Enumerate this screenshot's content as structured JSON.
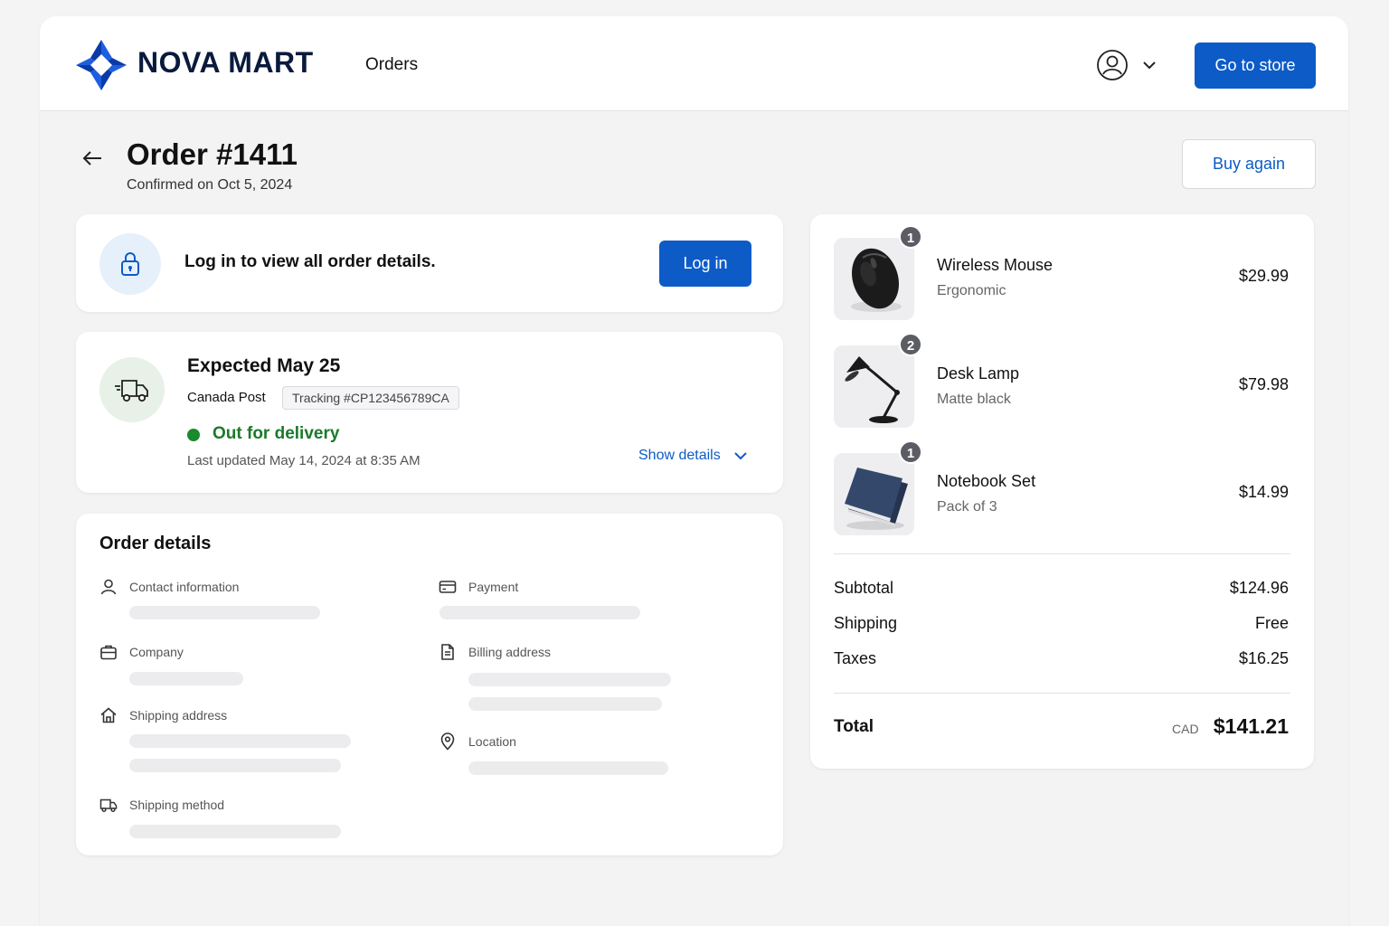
{
  "header": {
    "brand": "NOVA MART",
    "nav_orders": "Orders",
    "go_to_store": "Go to store",
    "accent": "#0d5bc7"
  },
  "order": {
    "title": "Order #1411",
    "confirmed": "Confirmed on Oct 5, 2024",
    "buy_again": "Buy again"
  },
  "login_card": {
    "message": "Log in to view all order details.",
    "button": "Log in"
  },
  "delivery": {
    "expected": "Expected May 25",
    "carrier": "Canada Post",
    "tracking": "Tracking #CP123456789CA",
    "status": "Out for delivery",
    "status_color": "#1a8a2e",
    "updated": "Last updated May 14, 2024 at 8:35 AM",
    "show_details": "Show details"
  },
  "details": {
    "title": "Order details",
    "fields": {
      "contact": "Contact information",
      "company": "Company",
      "shipping_address": "Shipping address",
      "shipping_method": "Shipping method",
      "payment": "Payment",
      "billing_address": "Billing address",
      "location": "Location"
    }
  },
  "items": [
    {
      "qty": "1",
      "name": "Wireless Mouse",
      "variant": "Ergonomic",
      "price": "$29.99"
    },
    {
      "qty": "2",
      "name": "Desk Lamp",
      "variant": "Matte black",
      "price": "$79.98"
    },
    {
      "qty": "1",
      "name": "Notebook Set",
      "variant": "Pack of 3",
      "price": "$14.99"
    }
  ],
  "summary": {
    "subtotal_label": "Subtotal",
    "subtotal": "$124.96",
    "shipping_label": "Shipping",
    "shipping": "Free",
    "taxes_label": "Taxes",
    "taxes": "$16.25",
    "total_label": "Total",
    "currency": "CAD",
    "total": "$141.21"
  }
}
